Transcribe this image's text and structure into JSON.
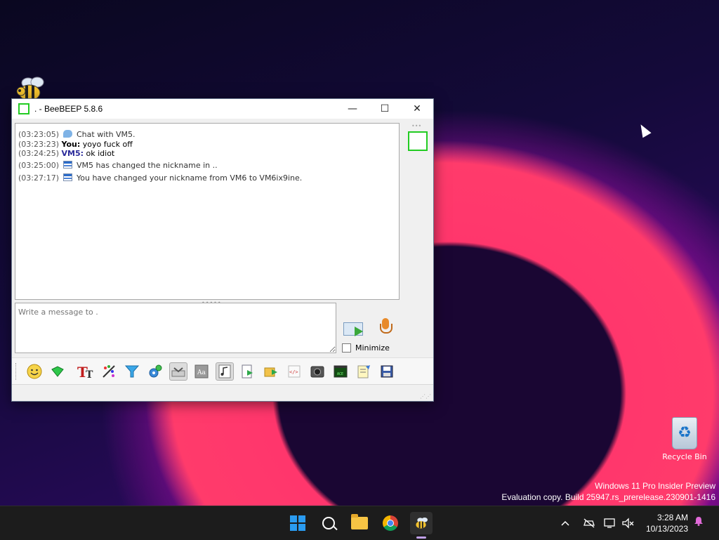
{
  "desktop": {
    "recycle_bin_label": "Recycle Bin",
    "watermark_line1": "Windows 11 Pro Insider Preview",
    "watermark_line2": "Evaluation copy. Build 25947.rs_prerelease.230901-1416"
  },
  "window": {
    "title": ". - BeeBEEP 5.8.6",
    "controls": {
      "minimize": "—",
      "maximize": "☐",
      "close": "✕"
    }
  },
  "chat": {
    "lines": [
      {
        "time": "(03:23:05)",
        "text": "Chat with VM5."
      },
      {
        "time": "(03:23:23)",
        "sender": "You:",
        "text": "yoyo fuck off"
      },
      {
        "time": "(03:24:25)",
        "sender": "VM5:",
        "text": "ok idiot"
      },
      {
        "time": "(03:25:00)",
        "text": "VM5 has changed the nickname in .."
      },
      {
        "time": "(03:27:17)",
        "text": "You have changed your nickname from VM6 to VM6ix9ine."
      }
    ]
  },
  "composer": {
    "placeholder": "Write a message to .",
    "minimize_label": "Minimize"
  },
  "toolbar": {
    "tools": [
      "emoticons-icon",
      "gem-icon",
      "font-icon",
      "color-icon",
      "filter-icon",
      "settings-icon",
      "inbox-icon",
      "text-style-icon",
      "music-note-icon",
      "send-file-icon",
      "send-folder-icon",
      "code-icon",
      "screenshot-icon",
      "terminal-icon",
      "notes-icon",
      "save-icon"
    ]
  },
  "taskbar": {
    "time": "3:28 AM",
    "date": "10/13/2023"
  },
  "colors": {
    "accent_green": "#22cc22",
    "sender_blue": "#2a2a9a"
  }
}
